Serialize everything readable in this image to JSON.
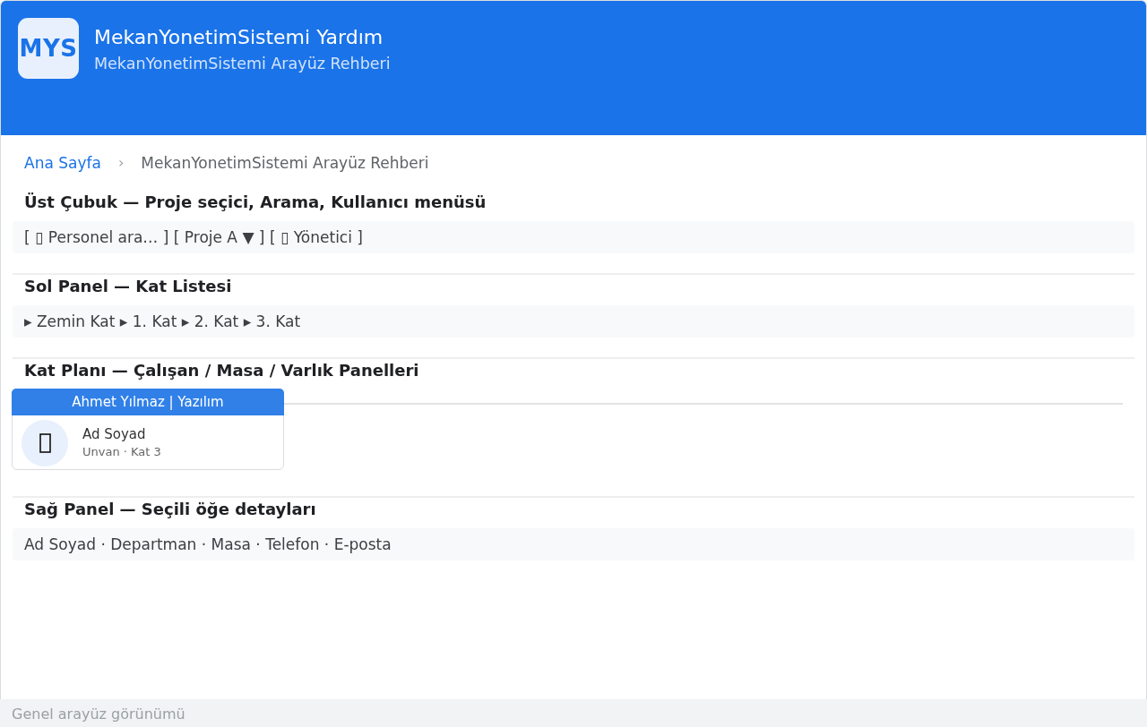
{
  "header": {
    "logo": "MYS",
    "title": "MekanYonetimSistemi Yardım",
    "subtitle": "MekanYonetimSistemi Arayüz Rehberi"
  },
  "breadcrumb": {
    "separator": "›",
    "items": [
      {
        "label": "Ana Sayfa",
        "kind": "link"
      },
      {
        "label": "MekanYonetimSistemi Arayüz Rehberi",
        "kind": "current"
      }
    ]
  },
  "sections": [
    {
      "kind": "text",
      "title": "Üst Çubuk — Proje seçici, Arama, Kullanıcı menüsü",
      "content": "[ ▯ Personel ara… ] [ Proje A ▼ ] [ ▯ Yönetici ]"
    },
    {
      "kind": "text",
      "title": "Sol Panel — Kat Listesi",
      "content": "▸ Zemin Kat ▸ 1. Kat ▸ 2. Kat ▸ 3. Kat"
    },
    {
      "kind": "card",
      "title": "Kat Planı — Çalışan / Masa / Varlık Panelleri",
      "card": {
        "header": "Ahmet Yılmaz | Yazılım",
        "name": "Ad Soyad",
        "meta": "Unvan · Kat 3"
      }
    },
    {
      "kind": "text",
      "title": "Sağ Panel — Seçili öğe detayları",
      "content": "Ad Soyad · Departman · Masa · Telefon · E-posta"
    }
  ],
  "status_bar": "Genel arayüz görünümü"
}
